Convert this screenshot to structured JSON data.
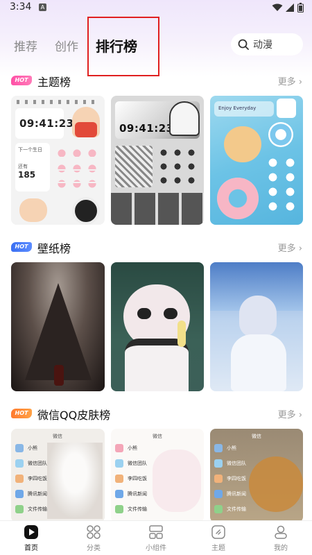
{
  "status_bar": {
    "time": "3:34",
    "notification_badge": "A"
  },
  "tabs": [
    {
      "label": "推荐",
      "active": false
    },
    {
      "label": "创作",
      "active": false
    },
    {
      "label": "排行榜",
      "active": true
    }
  ],
  "search": {
    "text": "动漫",
    "icon": "search-icon"
  },
  "sections": {
    "themes": {
      "badge": "HOT",
      "title": "主题榜",
      "more": "更多 ›"
    },
    "wallpapers": {
      "badge": "HOT",
      "title": "壁纸榜",
      "more": "更多 ›"
    },
    "skins": {
      "badge": "HOT",
      "title": "微信QQ皮肤榜",
      "more": "更多 ›"
    }
  },
  "theme_cards": [
    {
      "clock": "09:41:23",
      "countdown_label": "下一个生日",
      "countdown_prefix": "还有",
      "countdown_days": "185"
    },
    {
      "clock": "09:41:23"
    },
    {
      "caption": "Enjoy Everyday"
    }
  ],
  "skin_cards": [
    {
      "header": "微信",
      "rows": [
        "小熊",
        "微信团队",
        "李四吃饭",
        "腾讯新闻",
        "文件传输"
      ]
    },
    {
      "header": "微信",
      "rows": [
        "小熊",
        "微信团队",
        "李四吃饭",
        "腾讯新闻",
        "文件传输"
      ]
    },
    {
      "header": "微信",
      "rows": [
        "小熊",
        "微信团队",
        "李四吃饭",
        "腾讯新闻",
        "文件传输"
      ]
    }
  ],
  "bottom_nav": [
    {
      "label": "首页",
      "icon": "home-play-icon",
      "active": true
    },
    {
      "label": "分类",
      "icon": "grid-icon",
      "active": false
    },
    {
      "label": "小组件",
      "icon": "widget-icon",
      "active": false
    },
    {
      "label": "主题",
      "icon": "theme-icon",
      "active": false
    },
    {
      "label": "我的",
      "icon": "profile-icon",
      "active": false
    }
  ],
  "colors": {
    "accent_highlight": "#e02020",
    "hot_pink": "#ff4fa6",
    "hot_blue": "#3a6ff2",
    "hot_orange": "#ff7a2e"
  }
}
